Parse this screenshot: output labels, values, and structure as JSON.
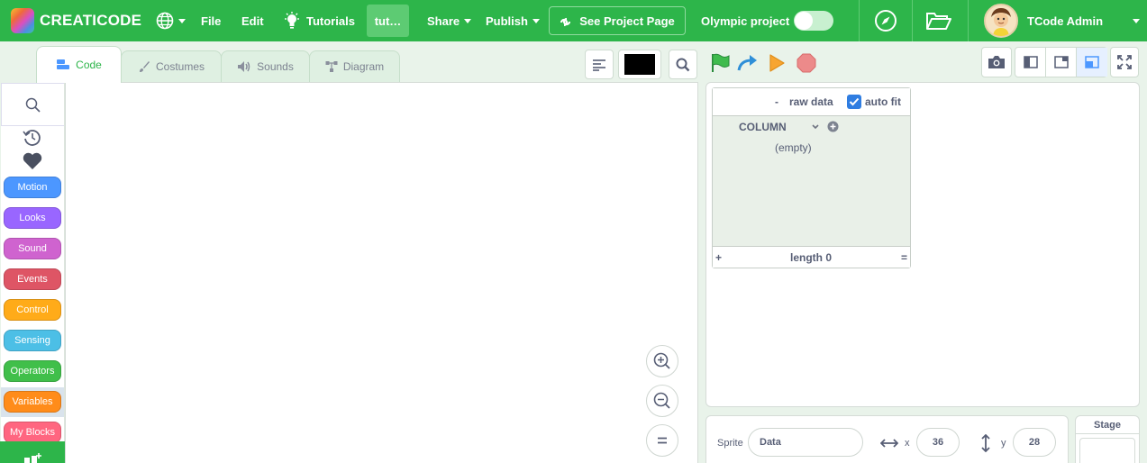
{
  "menu": {
    "brand": "CREATICODE",
    "file": "File",
    "edit": "Edit",
    "tutorials": "Tutorials",
    "project_title": "tut…",
    "share": "Share",
    "publish": "Publish",
    "see_project": "See Project Page",
    "olympic": "Olympic project",
    "olympic_enabled": false,
    "user": "TCode Admin"
  },
  "tabs": [
    {
      "label": "Code",
      "icon": "code-icon",
      "active": true
    },
    {
      "label": "Costumes",
      "icon": "brush-icon",
      "active": false
    },
    {
      "label": "Sounds",
      "icon": "speaker-icon",
      "active": false
    },
    {
      "label": "Diagram",
      "icon": "diagram-icon",
      "active": false
    }
  ],
  "categories": [
    {
      "label": "Motion",
      "color": "#4c97ff"
    },
    {
      "label": "Looks",
      "color": "#9966ff"
    },
    {
      "label": "Sound",
      "color": "#cf63cf"
    },
    {
      "label": "Events",
      "color": "#de5565"
    },
    {
      "label": "Control",
      "color": "#ffab19"
    },
    {
      "label": "Sensing",
      "color": "#4cbfe6"
    },
    {
      "label": "Operators",
      "color": "#40bf4a"
    },
    {
      "label": "Variables",
      "color": "#ff8c1a"
    },
    {
      "label": "My Blocks",
      "color": "#ff6680"
    }
  ],
  "list_monitor": {
    "minus": "-",
    "title": "raw data",
    "auto_fit": "auto fit",
    "auto_fit_checked": true,
    "column": "COLUMN",
    "empty": "(empty)",
    "plus": "+",
    "length": "length 0",
    "equals": "="
  },
  "sprite": {
    "label": "Sprite",
    "name": "Data",
    "x_label": "x",
    "x": "36",
    "y_label": "y",
    "y": "28"
  },
  "stage_panel": {
    "label": "Stage"
  },
  "colors": {
    "brand_green": "#2db54a",
    "pen_color": "#000000"
  }
}
